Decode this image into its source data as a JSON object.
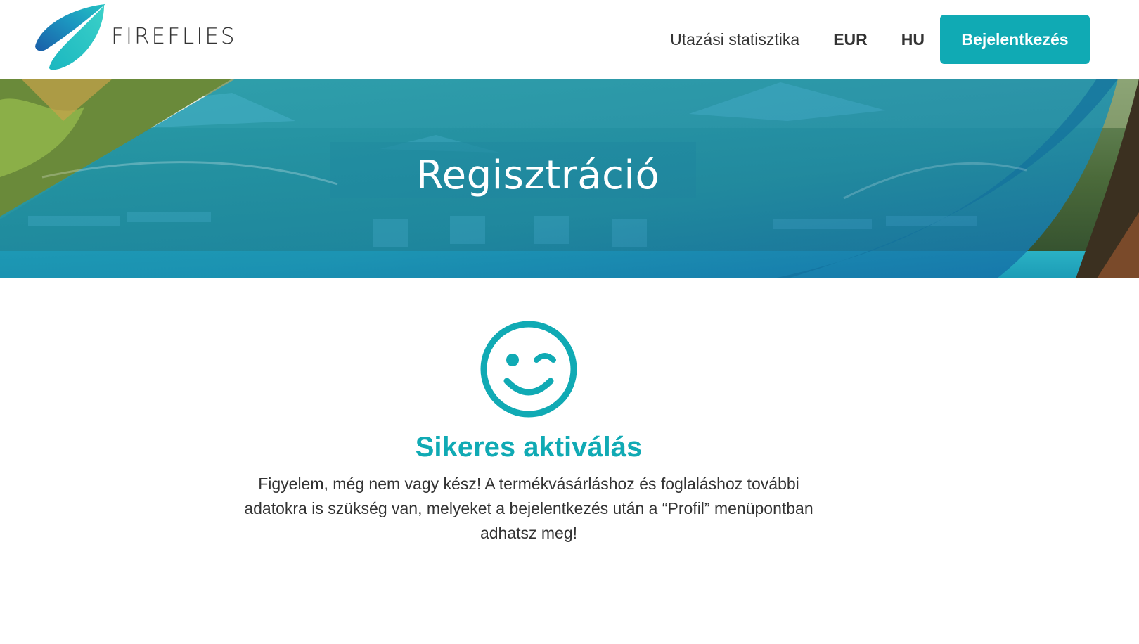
{
  "header": {
    "logo_text": "FIREFLIES",
    "nav": {
      "travel_stats": "Utazási statisztika",
      "currency": "EUR",
      "language": "HU",
      "login_button": "Bejelentkezés"
    }
  },
  "hero": {
    "title": "Regisztráció"
  },
  "main": {
    "icon": "wink-smiley-icon",
    "title": "Sikeres aktiválás",
    "message": "Figyelem, még nem vagy kész! A termékvásárláshoz és foglaláshoz további adatokra is szükség van, melyeket a bejelentkezés után a “Profil” menüpontban adhatsz meg!"
  },
  "colors": {
    "accent": "#10aab4",
    "hero_overlay": "#1b8fa6",
    "text": "#333333"
  }
}
